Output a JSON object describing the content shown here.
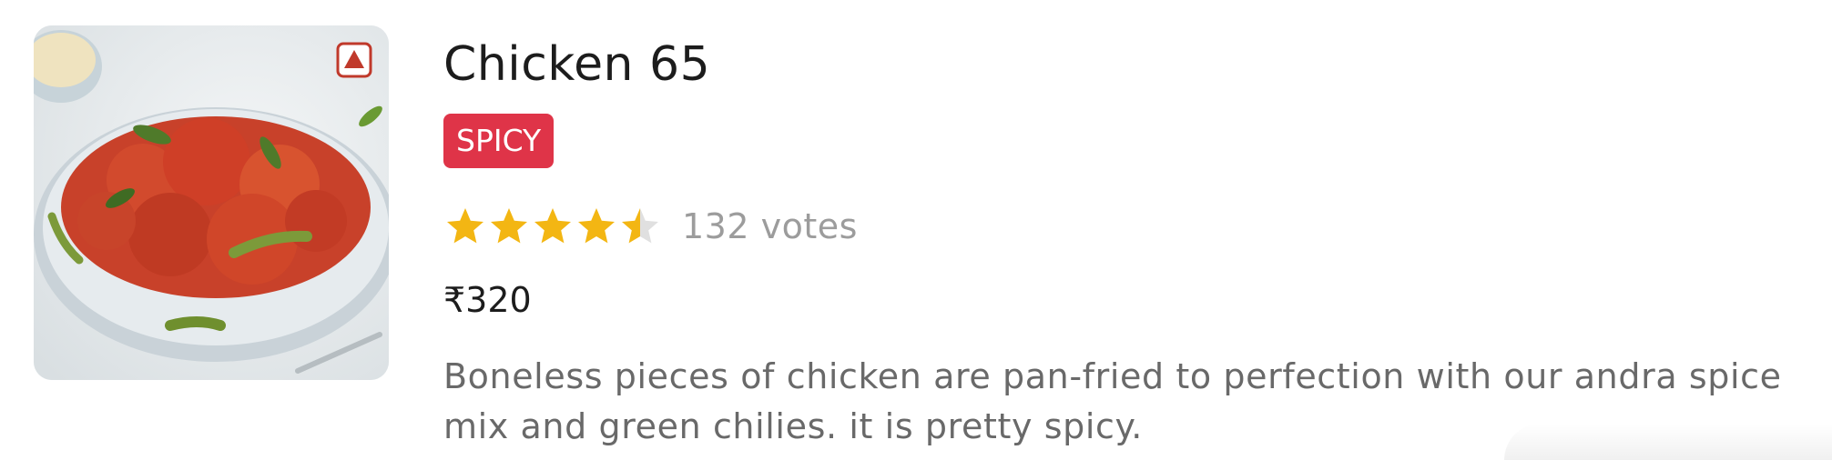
{
  "dish": {
    "name": "Chicken 65",
    "tag": "SPICY",
    "rating": 4.5,
    "rating_max": 5,
    "votes_text": "132 votes",
    "price": "₹320",
    "description": "Boneless pieces of chicken are pan-fried to perfection with our andra spice mix and green chilies. it is pretty spicy.",
    "image_icon": "dish-photo",
    "food_type_icon": "non-veg-mark-icon"
  },
  "colors": {
    "tag_bg": "#df3448",
    "star_filled": "#f3b613",
    "star_empty": "#e0e0e0",
    "non_veg_mark": "#c0392b"
  }
}
